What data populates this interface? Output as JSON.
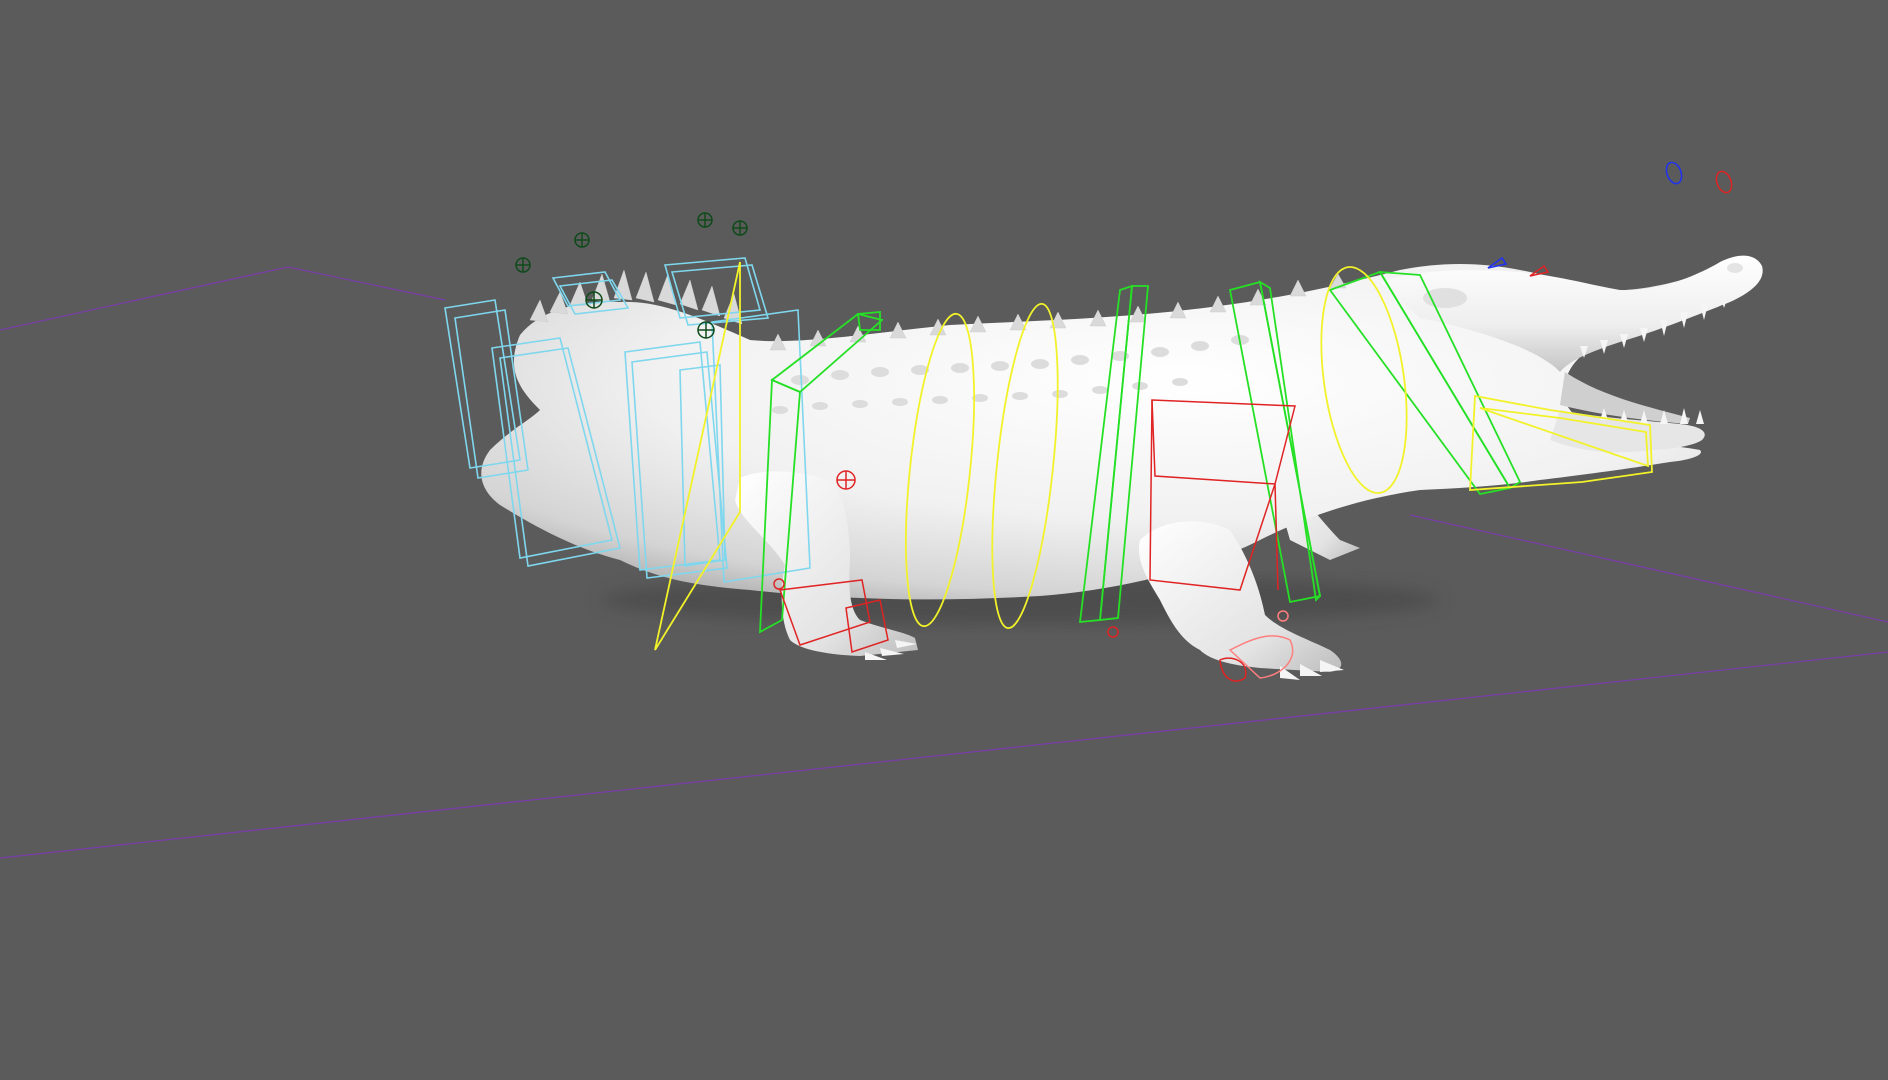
{
  "viewport": {
    "view": "perspective",
    "background_color": "#5b5b5b",
    "model": "crocodile-rig"
  },
  "colors": {
    "grid_line": "#7a3ea8",
    "control_cyan": "#7fd7ee",
    "control_green": "#26e026",
    "control_yellow": "#f2f22a",
    "control_red": "#e02424",
    "control_pink": "#ff7f7f",
    "control_blue": "#2233ee",
    "locator_dark_green": "#0f4a1a",
    "mesh": "#f2f2f2"
  },
  "rig_controls": {
    "tail_fk": "cyan",
    "spine_fk": "green",
    "spine_ik": "yellow",
    "legs_ik": "red",
    "jaw": "yellow",
    "eyes": [
      "blue",
      "red"
    ]
  }
}
